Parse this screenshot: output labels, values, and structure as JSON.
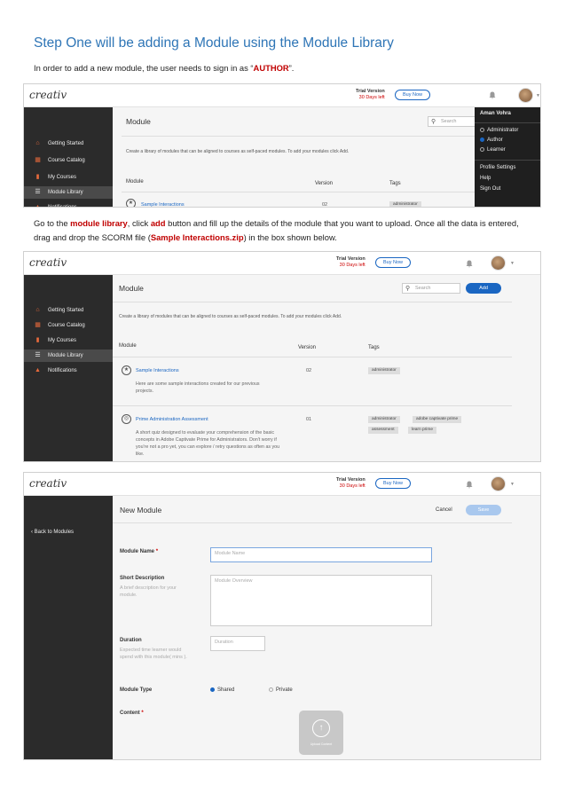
{
  "heading": "Step One will be adding a Module using the Module Library",
  "intro": {
    "before": "In order to add a new module, the user needs to sign in as “",
    "highlight": "AUTHOR",
    "after": "”."
  },
  "para2": {
    "t1": "Go to the ",
    "h1": "module library",
    "t2": ", click ",
    "h2": "add",
    "t3": " button and fill up the details of the module that you want to upload. Once all the data is entered, drag and drop the SCORM file (",
    "h3": "Sample Interactions.zip",
    "t4": ") in the box shown below."
  },
  "app": {
    "logo": "creativ",
    "trial_version": "Trial Version",
    "days_left": "30 Days left",
    "buy_now": "Buy Now",
    "sidebar": [
      "Getting Started",
      "Course Catalog",
      "My Courses",
      "Module Library",
      "Notifications"
    ],
    "module_title": "Module",
    "search_placeholder": "Search",
    "add_label": "Add",
    "library_desc": "Create a library of modules that can be aligned to courses as self-paced modules. To add your modules click Add.",
    "col_module": "Module",
    "col_version": "Version",
    "col_tags": "Tags"
  },
  "shot1": {
    "user_name": "Aman Vohra",
    "roles": [
      "Administrator",
      "Author",
      "Learner"
    ],
    "selected_role": "Author",
    "menu_items": [
      "Profile Settings",
      "Help",
      "Sign Out"
    ],
    "partial_row_title": "Sample Interactions",
    "partial_row_version": "02",
    "partial_row_tag": "administrator"
  },
  "shot2": {
    "modules": [
      {
        "title": "Sample Interactions",
        "version": "02",
        "description": "Here are some sample interactions created for our previous projects.",
        "tags": [
          "administrator"
        ]
      },
      {
        "title": "Prime Administration Assessment",
        "version": "01",
        "description": "A short quiz designed to evaluate your comprehension of the basic concepts in Adobe Captivate Prime for Administrators. Don't worry if you're not a pro yet, you can explore / retry questions as often as you like.",
        "tags": [
          "administrator",
          "adobe captivate prime",
          "assessment",
          "learn prime"
        ]
      }
    ]
  },
  "shot3": {
    "back": "Back to Modules",
    "title": "New Module",
    "cancel": "Cancel",
    "save": "Save",
    "fields": {
      "name_label": "Module Name",
      "name_placeholder": "Module Name",
      "short_label": "Short Description",
      "short_help": "A brief description for your module.",
      "short_placeholder": "Module Overview",
      "duration_label": "Duration",
      "duration_help": "Expected time learner would spend with this module( mins ).",
      "duration_placeholder": "Duration",
      "type_label": "Module Type",
      "type_shared": "Shared",
      "type_private": "Private",
      "content_label": "Content",
      "upload_label": "Upload Content"
    }
  }
}
